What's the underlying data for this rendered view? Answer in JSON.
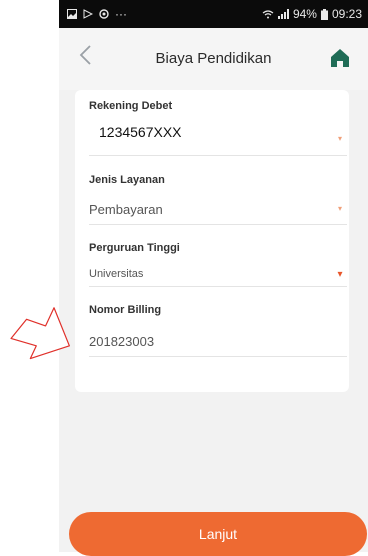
{
  "status_bar": {
    "more": "···",
    "battery_label": "94%",
    "time": "09:23"
  },
  "header": {
    "title": "Biaya Pendidikan"
  },
  "form": {
    "rekening_debet": {
      "label": "Rekening Debet",
      "value": "1234567XXX"
    },
    "jenis_layanan": {
      "label": "Jenis Layanan",
      "value": "Pembayaran"
    },
    "perguruan_tinggi": {
      "label": "Perguruan Tinggi",
      "value": "Universitas"
    },
    "nomor_billing": {
      "label": "Nomor Billing",
      "value": "201823003"
    }
  },
  "footer": {
    "submit_label": "Lanjut"
  },
  "colors": {
    "accent": "#ee6a32",
    "home_icon": "#1e6b55"
  }
}
